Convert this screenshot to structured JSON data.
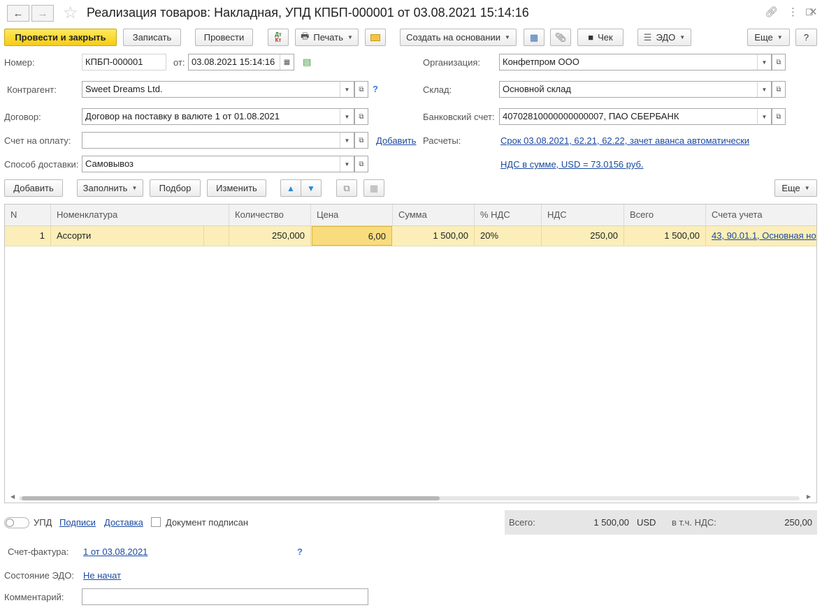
{
  "window": {
    "title": "Реализация товаров: Накладная, УПД КПБП-000001 от 03.08.2021 15:14:16"
  },
  "toolbar": {
    "post_close": "Провести и закрыть",
    "save": "Записать",
    "post": "Провести",
    "dt_kt": "Дт Кт",
    "print": "Печать",
    "create_based": "Создать на основании",
    "check": "Чек",
    "edo": "ЭДО",
    "more": "Еще",
    "help": "?"
  },
  "form": {
    "number_label": "Номер:",
    "number_value": "КПБП-000001",
    "date_label": "от:",
    "date_value": "03.08.2021 15:14:16",
    "contractor_label": "Контрагент:",
    "contractor_value": "Sweet Dreams Ltd.",
    "contract_label": "Договор:",
    "contract_value": "Договор на поставку в валюте 1 от 01.08.2021",
    "invoice_label": "Счет на оплату:",
    "invoice_value": "",
    "invoice_add": "Добавить",
    "delivery_label": "Способ доставки:",
    "delivery_value": "Самовывоз",
    "org_label": "Организация:",
    "org_value": "Конфетпром ООО",
    "warehouse_label": "Склад:",
    "warehouse_value": "Основной склад",
    "bank_label": "Банковский счет:",
    "bank_value": "40702810000000000007, ПАО СБЕРБАНК",
    "settlements_label": "Расчеты:",
    "settlements_link": "Срок 03.08.2021, 62.21, 62.22, зачет аванса автоматически",
    "vat_link": "НДС в сумме, USD = 73.0156 руб.",
    "help": "?"
  },
  "table_toolbar": {
    "add": "Добавить",
    "fill": "Заполнить",
    "pick": "Подбор",
    "change": "Изменить",
    "more": "Еще"
  },
  "table": {
    "columns": [
      "N",
      "Номенклатура",
      "Количество",
      "Цена",
      "Сумма",
      "% НДС",
      "НДС",
      "Всего",
      "Счета учета"
    ],
    "rows": [
      {
        "n": "1",
        "item": "Ассорти",
        "qty": "250,000",
        "price": "6,00",
        "sum": "1 500,00",
        "vat_rate": "20%",
        "vat": "250,00",
        "total": "1 500,00",
        "accounts": "43, 90.01.1, Основная но"
      }
    ]
  },
  "footer": {
    "upd_label": "УПД",
    "signatures_link": "Подписи",
    "delivery_link": "Доставка",
    "doc_signed_label": "Документ подписан",
    "total_label": "Всего:",
    "total_value": "1 500,00",
    "currency": "USD",
    "vat_incl_label": "в т.ч. НДС:",
    "vat_incl_value": "250,00",
    "invoice_label": "Счет-фактура:",
    "invoice_link": "1 от 03.08.2021",
    "invoice_help": "?",
    "edo_state_label": "Состояние ЭДО:",
    "edo_state_link": "Не начат",
    "comment_label": "Комментарий:",
    "comment_value": ""
  }
}
